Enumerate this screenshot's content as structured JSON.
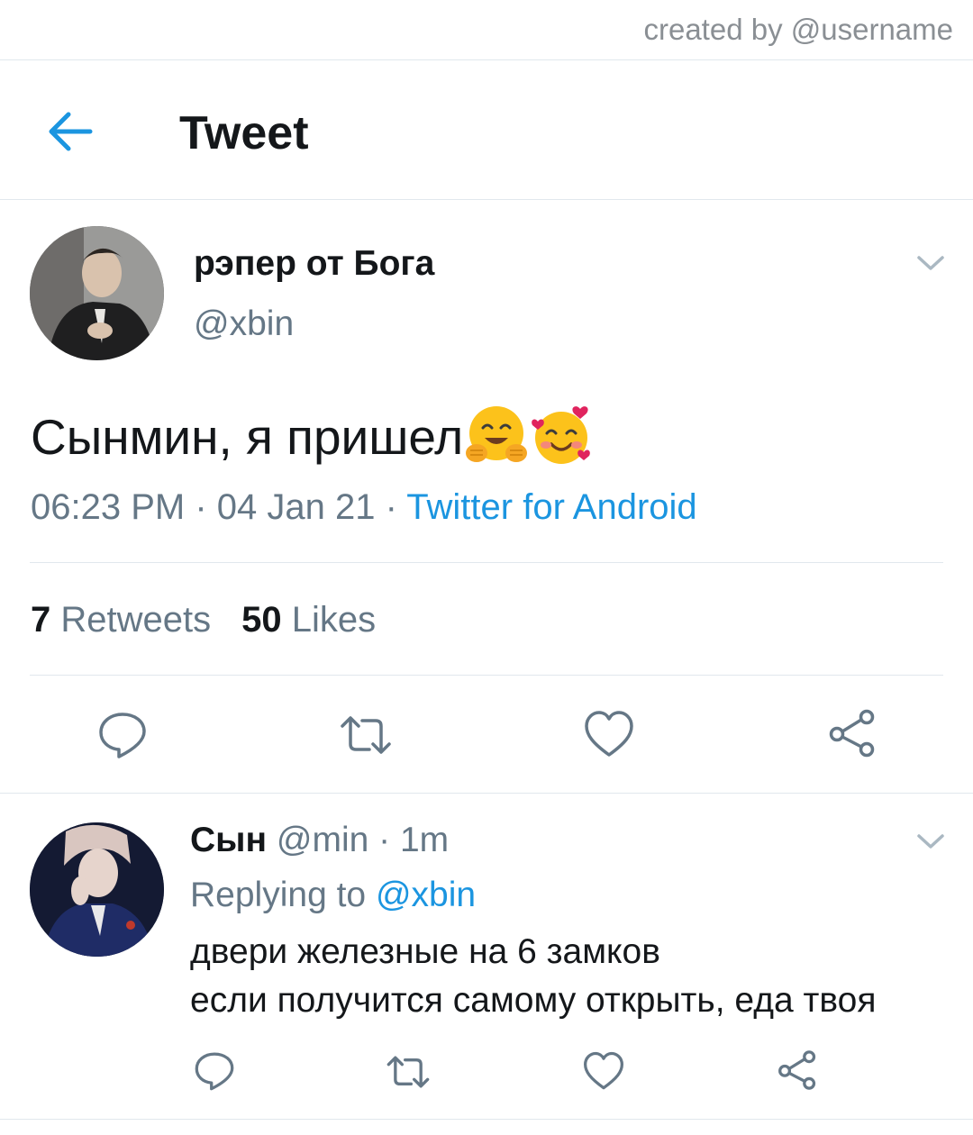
{
  "credit": "created by @username",
  "header": {
    "title": "Tweet",
    "back_icon": "arrow-left-icon"
  },
  "tweet": {
    "author_name": "рэпер от Бога",
    "handle": "@xbin",
    "text": "Сынмин, я пришел",
    "emojis": [
      "hugging-face-emoji",
      "smiling-face-with-hearts-emoji"
    ],
    "time": "06:23 PM",
    "sep1": " · ",
    "date": "04 Jan 21",
    "sep2": " · ",
    "source": "Twitter for Android",
    "retweets_count": "7",
    "retweets_label": "Retweets",
    "likes_count": "50",
    "likes_label": "Likes"
  },
  "reply": {
    "author_name": "Сын",
    "handle": "@min",
    "sep": " · ",
    "time_ago": "1m",
    "replying_label": "Replying to ",
    "replying_handle": "@xbin",
    "line1": "двери железные на 6 замков",
    "line2": "если получится самому открыть, еда твоя"
  },
  "colors": {
    "accent": "#1b95e0",
    "secondary_text": "#657786",
    "primary_text": "#14171a",
    "divider": "#e1e8ed",
    "icon_gray": "#657786"
  }
}
